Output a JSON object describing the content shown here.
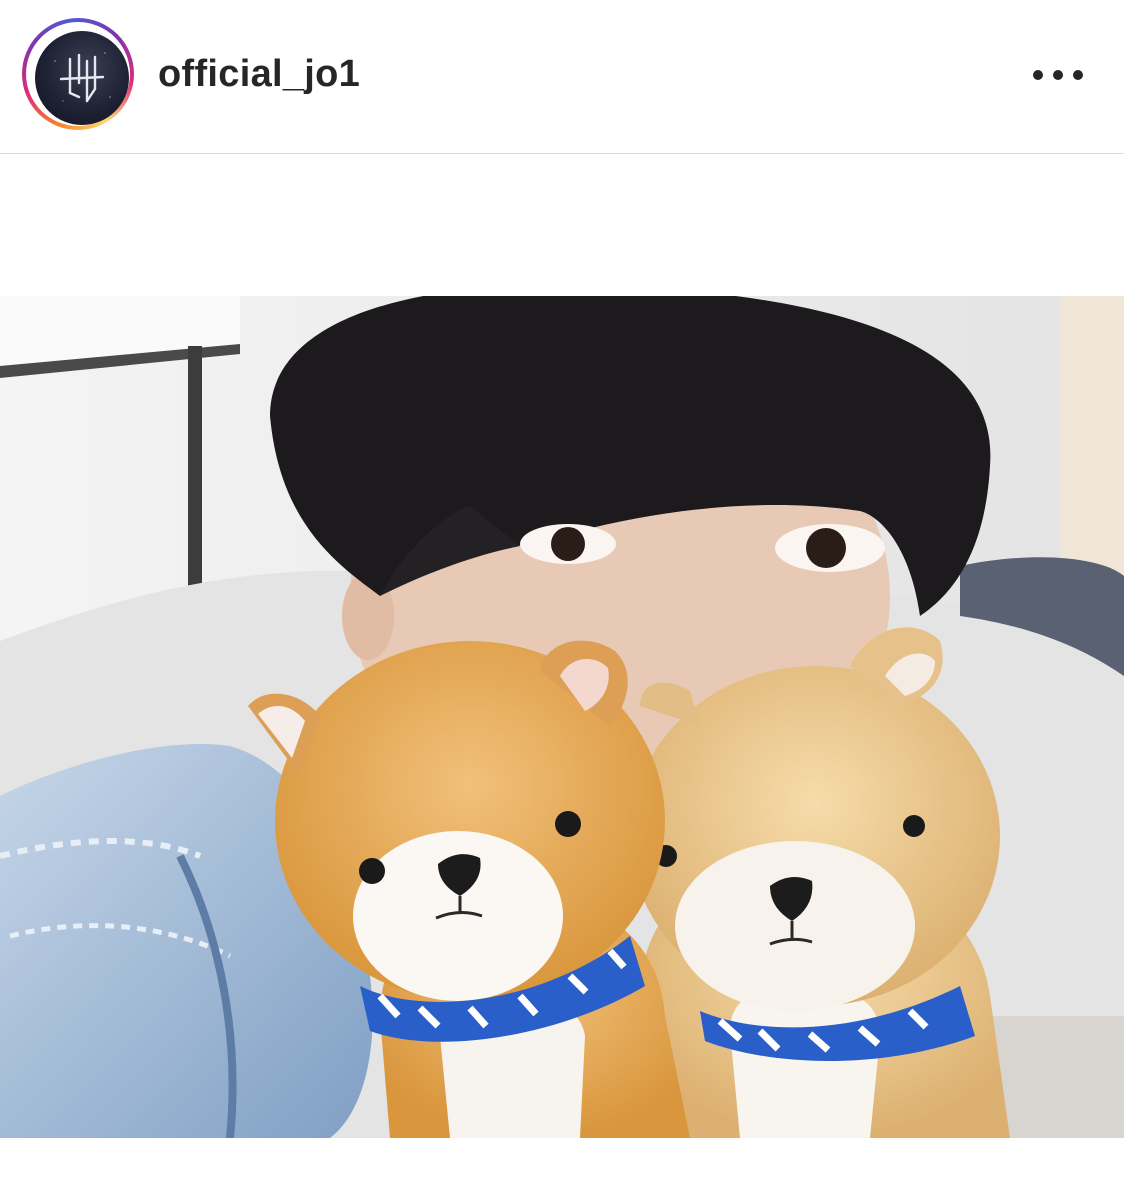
{
  "post": {
    "username": "official_jo1",
    "avatar_icon": "jo1-logo-icon",
    "more_icon": "more-options-icon",
    "ring_colors": [
      "#f58529",
      "#dd2a7b",
      "#8134af",
      "#515bd4"
    ]
  },
  "photo": {
    "subject": "selfie-with-plush-dogs"
  }
}
